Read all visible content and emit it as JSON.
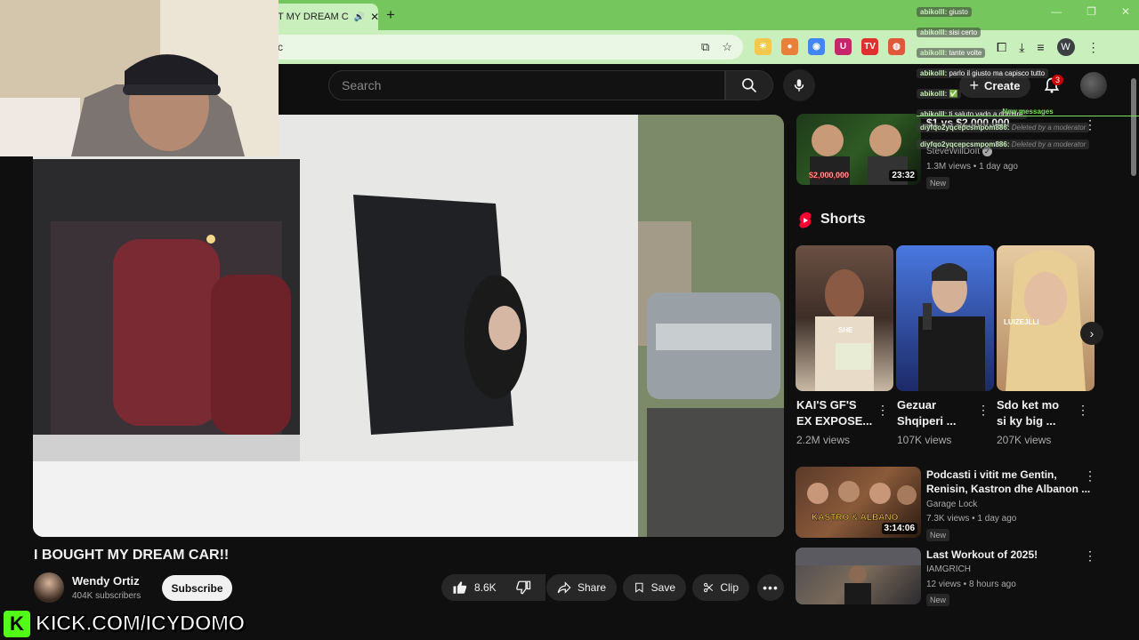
{
  "browser": {
    "tab_title": "T MY DREAM C",
    "new_tab": "+",
    "tab_close": "✕",
    "tab_audio": "🔊",
    "address_text": "c",
    "window_controls": [
      "—",
      "❐",
      "✕"
    ],
    "extensions": [
      {
        "name": "sun-extension",
        "label": "☀",
        "color": "#f2c94c"
      },
      {
        "name": "cookie-extension",
        "label": "●",
        "color": "#e8803a"
      },
      {
        "name": "chrome-extension",
        "label": "◉",
        "color": "#4285f4"
      },
      {
        "name": "u-extension",
        "label": "U",
        "color": "#c8256a"
      },
      {
        "name": "tv-extension",
        "label": "TV",
        "color": "#e03030"
      },
      {
        "name": "chat-extension",
        "label": "◍",
        "color": "#e0583a"
      }
    ],
    "profile_letter": "W"
  },
  "youtube": {
    "search_placeholder": "Search",
    "create_label": "Create",
    "notification_count": "3"
  },
  "video": {
    "title": "I BOUGHT MY DREAM CAR!!",
    "channel_name": "Wendy Ortiz",
    "subscribers": "404K subscribers",
    "subscribe_label": "Subscribe",
    "likes": "8.6K",
    "share_label": "Share",
    "save_label": "Save",
    "clip_label": "Clip"
  },
  "sidebar": {
    "top_video": {
      "title": "$1 vs $2,000,000",
      "channel": "SteveWillDoIt",
      "meta": "1.3M views • 1 day ago",
      "badge": "New",
      "duration": "23:32",
      "thumb_text": "$2,000,000"
    },
    "shorts_label": "Shorts",
    "shorts": [
      {
        "title_l1": "KAI'S GF'S",
        "title_l2": "EX EXPOSE...",
        "views": "2.2M views",
        "color1": "#6b5044",
        "color2": "#e8d8c4",
        "overlay": "SHE"
      },
      {
        "title_l1": "Gezuar",
        "title_l2": "Shqiperi ...",
        "views": "107K views",
        "color1": "#3b62c6",
        "color2": "#1c2a68",
        "overlay": ""
      },
      {
        "title_l1": "Sdo ket mo",
        "title_l2": "si ky big ...",
        "views": "207K views",
        "color1": "#d8b48a",
        "color2": "#f3dfc2",
        "overlay": "LUIZEJLLI"
      }
    ],
    "videos": [
      {
        "title_l1": "Podcasti i vitit me Gentin,",
        "title_l2": "Renisin, Kastron dhe Albanon ...",
        "channel": "Garage Lock",
        "meta": "7.3K views • 1 day ago",
        "badge": "New",
        "duration": "3:14:06",
        "thumb_text": "KASTRO & ALBANO"
      },
      {
        "title_l1": "Last Workout of 2025!",
        "title_l2": "",
        "channel": "IAMGRICH",
        "meta": "12 views • 8 hours ago",
        "badge": "New",
        "duration": "",
        "thumb_text": ""
      }
    ]
  },
  "chat": {
    "messages": [
      {
        "user": "abikolll:",
        "text": "giusto"
      },
      {
        "user": "abikolll:",
        "text": "sisi certo"
      },
      {
        "user": "abikolll:",
        "text": "tante volte"
      },
      {
        "user": "abikolll:",
        "text": "parlo il giusto ma capisco tutto"
      },
      {
        "user": "abikolll:",
        "text": "✅"
      },
      {
        "user": "abikolll:",
        "text": "ti saluto vado a dormire"
      }
    ],
    "new_messages_label": "New messages",
    "deleted": [
      {
        "user": "diyfqo2yqcepcsmpom886:",
        "text": "Deleted by a moderator"
      },
      {
        "user": "diyfqo2yqcepcsmpom886:",
        "text": "Deleted by a moderator"
      }
    ]
  },
  "overlay": {
    "kick_logo": "K",
    "kick_url": "KICK.COM/ICYDOMO"
  }
}
